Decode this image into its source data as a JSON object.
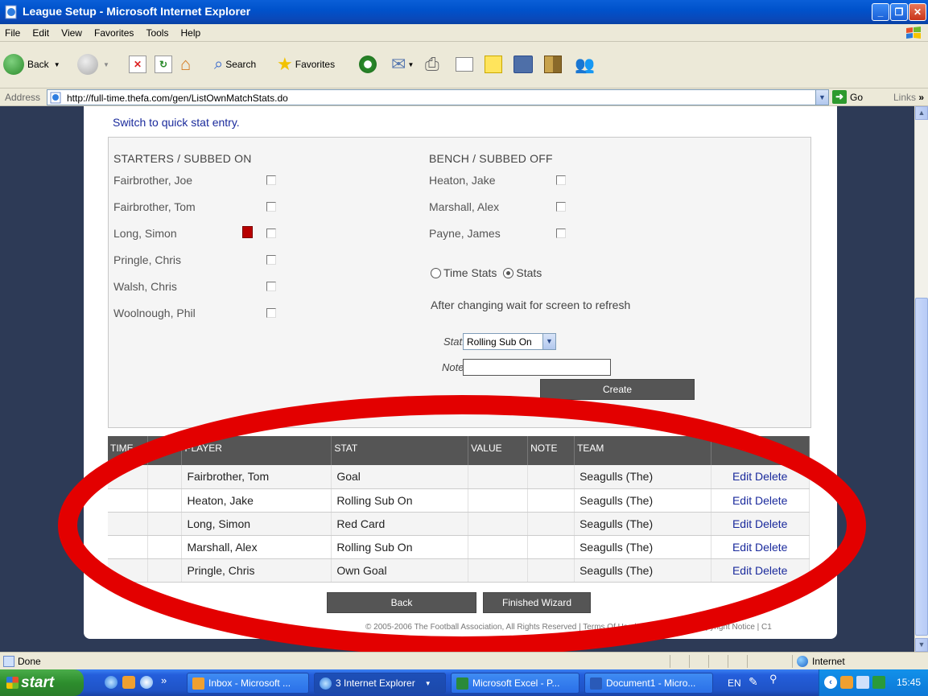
{
  "window": {
    "title": "League Setup - Microsoft Internet Explorer"
  },
  "menu": {
    "items": [
      "File",
      "Edit",
      "View",
      "Favorites",
      "Tools",
      "Help"
    ]
  },
  "toolbar": {
    "back_label": "Back",
    "search_label": "Search",
    "favorites_label": "Favorites"
  },
  "address": {
    "label": "Address",
    "url": "http://full-time.thefa.com/gen/ListOwnMatchStats.do",
    "go_label": "Go",
    "links_label": "Links"
  },
  "page": {
    "switch_link": "Switch to quick stat entry.",
    "starters_heading": "STARTERS / SUBBED ON",
    "bench_heading": "BENCH / SUBBED OFF",
    "starters": [
      {
        "name": "Fairbrother, Joe",
        "red_card": false
      },
      {
        "name": "Fairbrother, Tom",
        "red_card": false
      },
      {
        "name": "Long, Simon",
        "red_card": true
      },
      {
        "name": "Pringle, Chris",
        "red_card": false
      },
      {
        "name": "Walsh, Chris",
        "red_card": false
      },
      {
        "name": "Woolnough, Phil",
        "red_card": false
      }
    ],
    "bench": [
      {
        "name": "Heaton, Jake"
      },
      {
        "name": "Marshall, Alex"
      },
      {
        "name": "Payne, James"
      }
    ],
    "radio_time_stats": "Time Stats",
    "radio_stats": "Stats",
    "radio_selected": "Stats",
    "refresh_hint": "After changing wait for screen to refresh",
    "stat_label": "Stat:",
    "stat_value": "Rolling Sub On",
    "note_label": "Note:",
    "note_value": "",
    "create_label": "Create",
    "table": {
      "headers": [
        "TIME",
        "NO.",
        "PLAYER",
        "STAT",
        "VALUE",
        "NOTE",
        "TEAM",
        ""
      ],
      "rows": [
        {
          "time": "",
          "no": "",
          "player": "Fairbrother, Tom",
          "stat": "Goal",
          "value": "",
          "note": "",
          "team": "Seagulls (The)",
          "actions": "Edit Delete"
        },
        {
          "time": "",
          "no": "",
          "player": "Heaton, Jake",
          "stat": "Rolling Sub On",
          "value": "",
          "note": "",
          "team": "Seagulls (The)",
          "actions": "Edit Delete"
        },
        {
          "time": "",
          "no": "",
          "player": "Long, Simon",
          "stat": "Red Card",
          "value": "",
          "note": "",
          "team": "Seagulls (The)",
          "actions": "Edit Delete"
        },
        {
          "time": "",
          "no": "",
          "player": "Marshall, Alex",
          "stat": "Rolling Sub On",
          "value": "",
          "note": "",
          "team": "Seagulls (The)",
          "actions": "Edit Delete"
        },
        {
          "time": "",
          "no": "",
          "player": "Pringle, Chris",
          "stat": "Own Goal",
          "value": "",
          "note": "",
          "team": "Seagulls (The)",
          "actions": "Edit Delete"
        }
      ]
    },
    "back_label": "Back",
    "finish_label": "Finished Wizard",
    "footer": "© 2005-2006 The Football Association, All Rights Reserved | Terms Of Use | Privacy Policy | Copyright Notice | C1"
  },
  "status": {
    "text": "Done",
    "zone": "Internet"
  },
  "taskbar": {
    "start_label": "start",
    "tasks": [
      "Inbox - Microsoft ...",
      "3 Internet Explorer",
      "Microsoft Excel - P...",
      "Document1 - Micro..."
    ],
    "lang": "EN",
    "clock": "15:45"
  },
  "colors": {
    "annotation_ring": "#e30000",
    "page_bg": "#2d3a56",
    "header_bg": "#555555",
    "red_card": "#b80000"
  }
}
